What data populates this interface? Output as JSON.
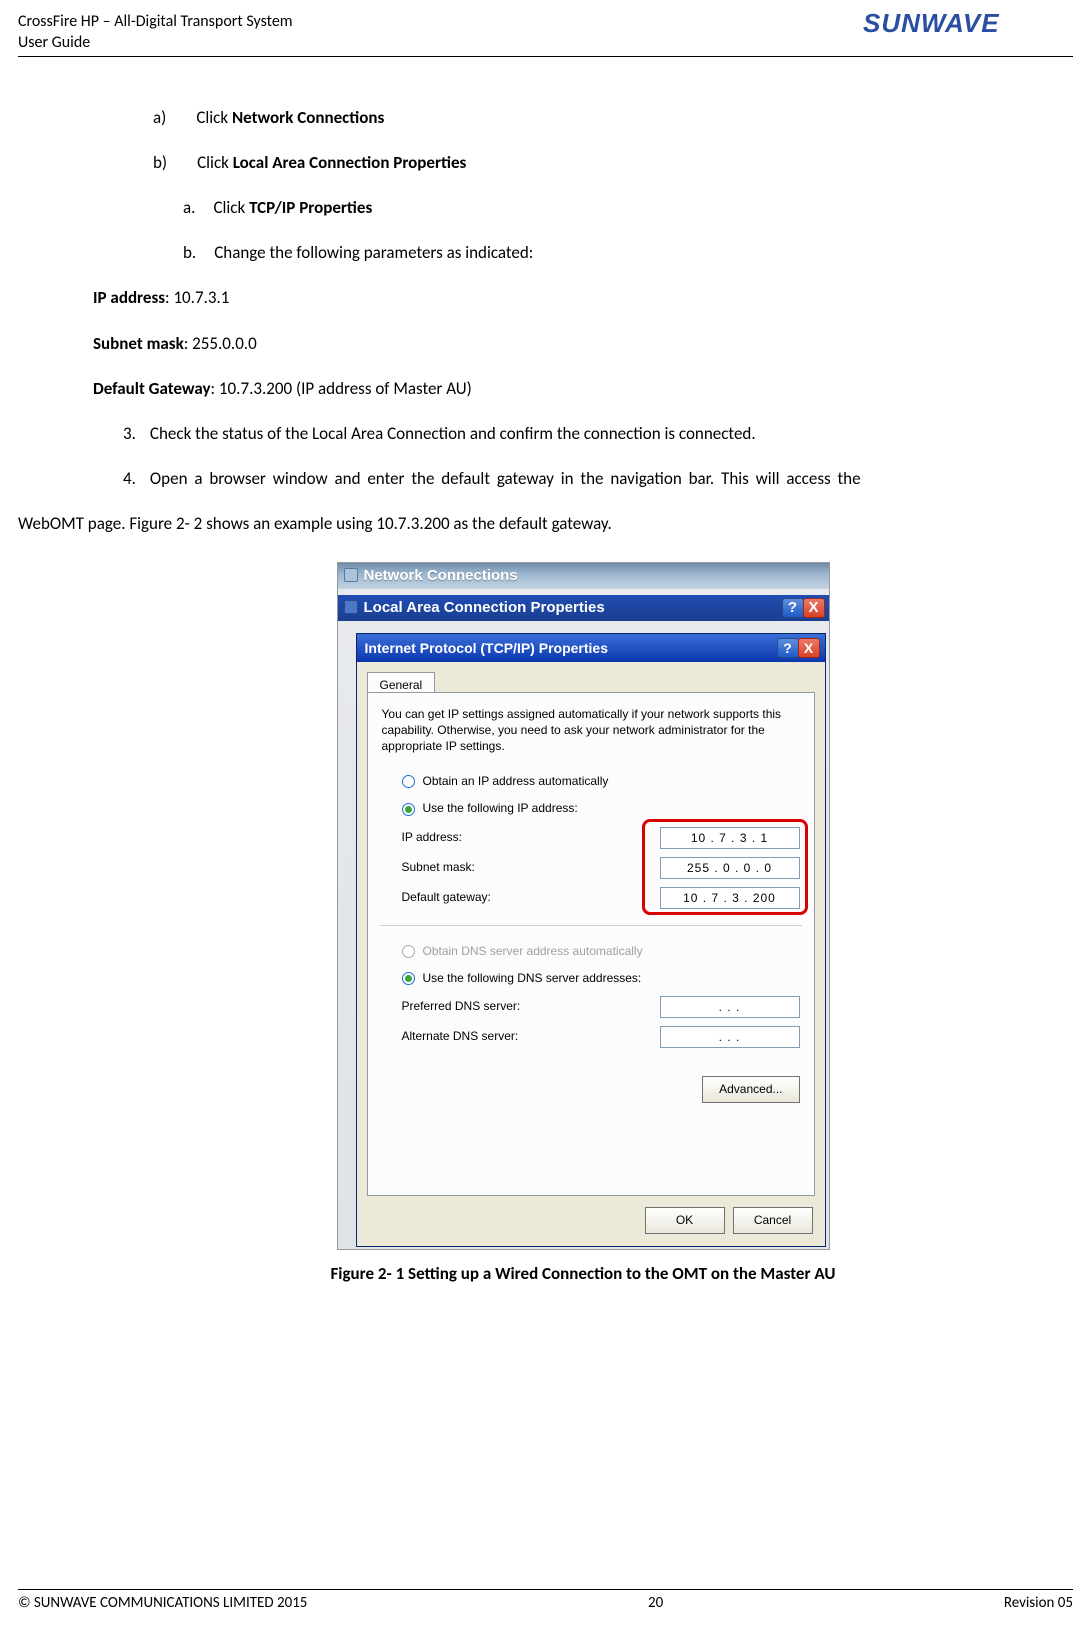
{
  "header": {
    "line1": "CrossFire HP – All-Digital Transport System",
    "line2": "User Guide",
    "logo_text": "SUNWAVE"
  },
  "body": {
    "item_a_label": "a)",
    "item_a_text_pre": "Click ",
    "item_a_bold": "Network Connections",
    "item_b_label": "b)",
    "item_b_text_pre": "Click ",
    "item_b_bold": "Local Area Connection Properties",
    "sub_a_label": "a.",
    "sub_a_pre": "Click ",
    "sub_a_bold": "TCP/IP Properties",
    "sub_b_label": "b.",
    "sub_b_text": "Change the following parameters as indicated:",
    "ip_label": "IP address",
    "ip_value": ": 10.7.3.1",
    "subnet_label": "Subnet mask",
    "subnet_value": ": 255.0.0.0",
    "gateway_label": "Default Gateway",
    "gateway_value": ": 10.7.3.200 (IP address of Master AU)",
    "num3_label": "3.",
    "num3_text": "Check the status of the Local Area Connection and confirm the connection is connected.",
    "num4_label": "4.",
    "num4_text": "Open a browser window and enter the default gateway in the navigation bar. This will access the",
    "final_para": "WebOMT page. Figure 2- 2 shows an example using 10.7.3.200 as the default gateway.",
    "figure_caption": "Figure 2- 1 Setting up a Wired Connection to the OMT on the Master AU"
  },
  "screenshot": {
    "nc_title": "Network Connections",
    "lac_title": "Local Area Connection Properties",
    "tcpip_title": "Internet Protocol (TCP/IP) Properties",
    "tab_general": "General",
    "intro": "You can get IP settings assigned automatically if your network supports this capability. Otherwise, you need to ask your network administrator for the appropriate IP settings.",
    "radio_obtain_ip": "Obtain an IP address automatically",
    "radio_use_ip": "Use the following IP address:",
    "lbl_ip": "IP address:",
    "val_ip": "10  .   7   .   3   .   1",
    "lbl_subnet": "Subnet mask:",
    "val_subnet": "255 .   0   .   0   .   0",
    "lbl_gateway": "Default gateway:",
    "val_gateway": "10  .   7   .   3   . 200",
    "radio_obtain_dns": "Obtain DNS server address automatically",
    "radio_use_dns": "Use the following DNS server addresses:",
    "lbl_pref_dns": "Preferred DNS server:",
    "val_pref_dns": ".         .         .",
    "lbl_alt_dns": "Alternate DNS server:",
    "val_alt_dns": ".         .         .",
    "btn_advanced": "Advanced...",
    "btn_ok": "OK",
    "btn_cancel": "Cancel",
    "help_q": "?",
    "close_x": "X"
  },
  "footer": {
    "left": "© SUNWAVE COMMUNICATIONS LIMITED 2015",
    "center": "20",
    "right": "Revision 05"
  }
}
